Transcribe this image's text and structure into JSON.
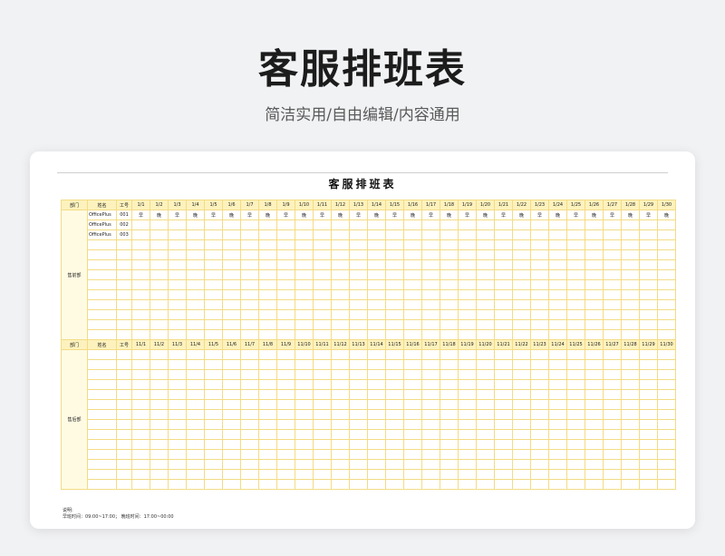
{
  "header": {
    "title": "客服排班表",
    "subtitle": "简洁实用/自由编辑/内容通用"
  },
  "sheet": {
    "title": "客服排班表",
    "columns": {
      "dept": "部门",
      "name": "姓名",
      "id": "工号"
    },
    "section1": {
      "dept_label": "售前部",
      "dates": [
        "1/1",
        "1/2",
        "1/3",
        "1/4",
        "1/5",
        "1/6",
        "1/7",
        "1/8",
        "1/9",
        "1/10",
        "1/11",
        "1/12",
        "1/13",
        "1/14",
        "1/15",
        "1/16",
        "1/17",
        "1/18",
        "1/19",
        "1/20",
        "1/21",
        "1/22",
        "1/23",
        "1/24",
        "1/25",
        "1/26",
        "1/27",
        "1/28",
        "1/29",
        "1/30"
      ],
      "rows": [
        {
          "name": "OfficePlus",
          "id": "001",
          "shifts": [
            "早",
            "晚",
            "早",
            "晚",
            "早",
            "晚",
            "早",
            "晚",
            "早",
            "晚",
            "早",
            "晚",
            "早",
            "晚",
            "早",
            "晚",
            "早",
            "晚",
            "早",
            "晚",
            "早",
            "晚",
            "早",
            "晚",
            "早",
            "晚",
            "早",
            "晚",
            "早",
            "晚"
          ]
        },
        {
          "name": "OfficePlus",
          "id": "002",
          "shifts": []
        },
        {
          "name": "OfficePlus",
          "id": "003",
          "shifts": []
        },
        {
          "name": "",
          "id": "",
          "shifts": []
        },
        {
          "name": "",
          "id": "",
          "shifts": []
        },
        {
          "name": "",
          "id": "",
          "shifts": []
        },
        {
          "name": "",
          "id": "",
          "shifts": []
        },
        {
          "name": "",
          "id": "",
          "shifts": []
        },
        {
          "name": "",
          "id": "",
          "shifts": []
        },
        {
          "name": "",
          "id": "",
          "shifts": []
        },
        {
          "name": "",
          "id": "",
          "shifts": []
        },
        {
          "name": "",
          "id": "",
          "shifts": []
        },
        {
          "name": "",
          "id": "",
          "shifts": []
        }
      ]
    },
    "section2": {
      "dept_label": "售后部",
      "dates": [
        "11/1",
        "11/2",
        "11/3",
        "11/4",
        "11/5",
        "11/6",
        "11/7",
        "11/8",
        "11/9",
        "11/10",
        "11/11",
        "11/12",
        "11/13",
        "11/14",
        "11/15",
        "11/16",
        "11/17",
        "11/18",
        "11/19",
        "11/20",
        "11/21",
        "11/22",
        "11/23",
        "11/24",
        "11/25",
        "11/26",
        "11/27",
        "11/28",
        "11/29",
        "11/30"
      ],
      "row_count": 14
    },
    "notes": {
      "label": "说明:",
      "text": "早班时间：09:00~17:00；  晚班时间：17:00~00:00"
    }
  }
}
